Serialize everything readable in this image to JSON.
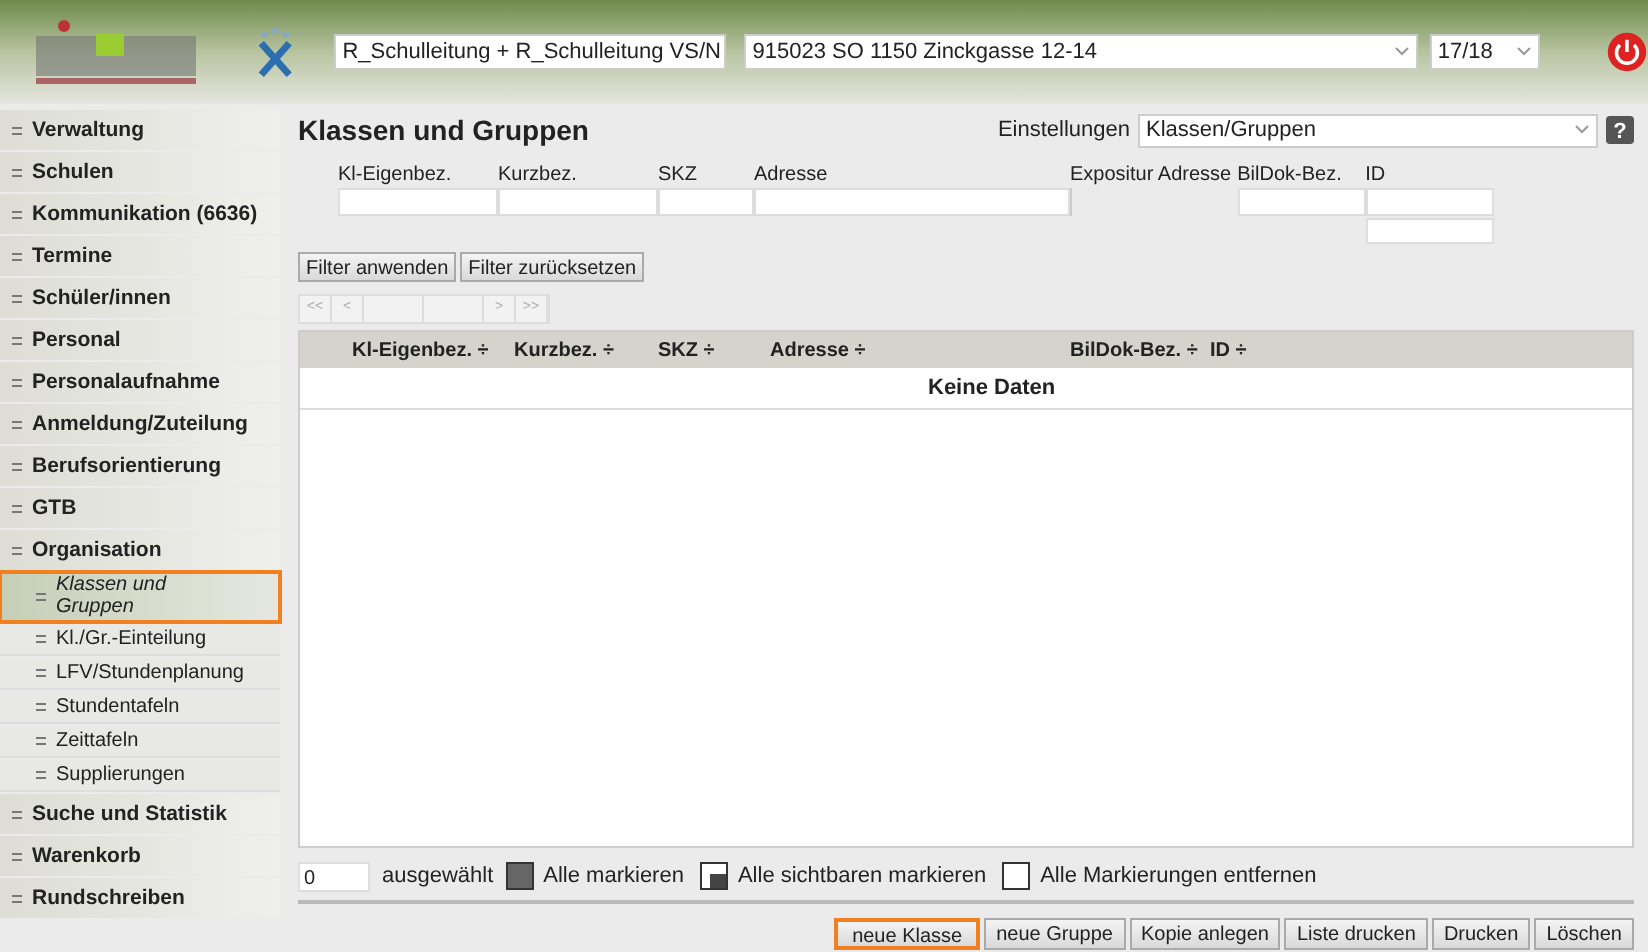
{
  "header": {
    "role_select": "R_Schulleitung + R_Schulleitung VS/N",
    "school_select": "915023 SO 1150 Zinckgasse 12-14",
    "year_select": "17/18"
  },
  "sidebar": {
    "items": [
      {
        "label": "Verwaltung",
        "highlighted": false
      },
      {
        "label": "Schulen",
        "highlighted": false
      },
      {
        "label": "Kommunikation (6636)",
        "highlighted": false
      },
      {
        "label": "Termine",
        "highlighted": false
      },
      {
        "label": "Schüler/innen",
        "highlighted": false
      },
      {
        "label": "Personal",
        "highlighted": false
      },
      {
        "label": "Personalaufnahme",
        "highlighted": false
      },
      {
        "label": "Anmeldung/Zuteilung",
        "highlighted": false
      },
      {
        "label": "Berufsorientierung",
        "highlighted": false
      },
      {
        "label": "GTB",
        "highlighted": false
      },
      {
        "label": "Organisation",
        "highlighted": false,
        "children": [
          {
            "label": "Klassen und Gruppen",
            "highlighted": true,
            "selected": true
          },
          {
            "label": "Kl./Gr.-Einteilung",
            "highlighted": false,
            "selected": false
          },
          {
            "label": "LFV/Stundenplanung",
            "highlighted": false,
            "selected": false
          },
          {
            "label": "Stundentafeln",
            "highlighted": false,
            "selected": false
          },
          {
            "label": "Zeittafeln",
            "highlighted": false,
            "selected": false
          },
          {
            "label": "Supplierungen",
            "highlighted": false,
            "selected": false
          }
        ]
      },
      {
        "label": "Suche und Statistik",
        "highlighted": false
      },
      {
        "label": "Warenkorb",
        "highlighted": false
      },
      {
        "label": "Rundschreiben",
        "highlighted": false
      }
    ]
  },
  "main": {
    "title": "Klassen und Gruppen",
    "settings_label": "Einstellungen",
    "settings_select": "Klassen/Gruppen",
    "help": "?",
    "filters": [
      {
        "label": "Kl-Eigenbez.",
        "kind": "input"
      },
      {
        "label": "Kurzbez.",
        "kind": "input"
      },
      {
        "label": "SKZ",
        "kind": "input"
      },
      {
        "label": "Adresse",
        "kind": "input"
      },
      {
        "label": "Expositur Adresse",
        "kind": "none"
      },
      {
        "label": "BilDok-Bez.",
        "kind": "input"
      },
      {
        "label": "ID",
        "kind": "double"
      }
    ],
    "filter_buttons": [
      "Filter anwenden",
      "Filter zurücksetzen"
    ],
    "pager": {
      "first": "<<",
      "prev": "<",
      "next": ">",
      "last": ">>"
    },
    "table": {
      "columns": [
        "Kl-Eigenbez. ÷",
        "Kurzbez. ÷",
        "SKZ ÷",
        "Adresse ÷",
        "BilDok-Bez. ÷",
        "ID ÷"
      ],
      "empty_text": "Keine Daten"
    },
    "selection": {
      "count": "0",
      "count_label": "ausgewählt",
      "actions": [
        {
          "label": "Alle markieren",
          "kind": "filled"
        },
        {
          "label": "Alle sichtbaren markieren",
          "kind": "partial"
        },
        {
          "label": "Alle Markierungen entfernen",
          "kind": "empty"
        }
      ]
    },
    "buttons": [
      {
        "label": "neue Klasse",
        "highlighted": true
      },
      {
        "label": "neue Gruppe",
        "highlighted": false
      },
      {
        "label": "Kopie anlegen",
        "highlighted": false
      },
      {
        "label": "Liste drucken",
        "highlighted": false
      },
      {
        "label": "Drucken",
        "highlighted": false
      },
      {
        "label": "Löschen",
        "highlighted": false
      }
    ]
  }
}
